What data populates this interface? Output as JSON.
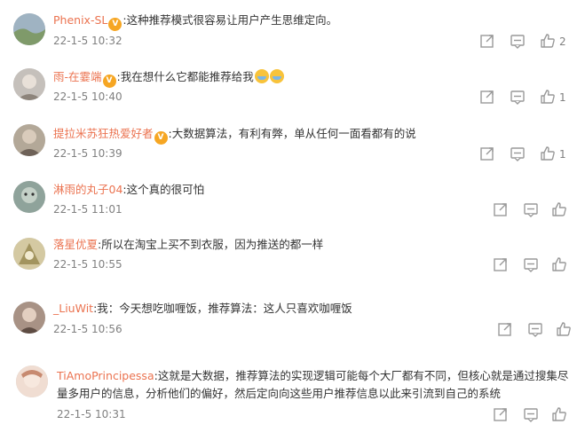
{
  "comments": [
    {
      "user": "Phenix-SL",
      "text": ":这种推荐模式很容易让用户产生思维定向。",
      "time": "22-1-5 10:32",
      "likes": "2",
      "avatar_color": "#8aa37c"
    },
    {
      "user": "雨-在霎端",
      "text": ":我在想什么它都能推荐给我",
      "time": "22-1-5 10:40",
      "likes": "1",
      "avatar_color": "#b9b3ad"
    },
    {
      "user": "提拉米苏狂热爱好者",
      "text": ":大数据算法，有利有弊，单从任何一面看都有的说",
      "time": "22-1-5 10:39",
      "likes": "1",
      "avatar_color": "#a69a8c"
    },
    {
      "user": "淋雨的丸子04",
      "text": ":这个真的很可怕",
      "time": "22-1-5 11:01",
      "likes": "",
      "avatar_color": "#7d8f86"
    },
    {
      "user": "落星优夏",
      "text": ":所以在淘宝上买不到衣服，因为推送的都一样",
      "time": "22-1-5 10:55",
      "likes": "",
      "avatar_color": "#c8b98a"
    },
    {
      "user": "_LiuWit",
      "text": ":我：今天想吃咖喱饭，推荐算法：这人只喜欢咖喱饭",
      "time": "22-1-5 10:56",
      "likes": "",
      "avatar_color": "#9f8c80"
    },
    {
      "user": "TiAmoPrincipessa",
      "text": ":这就是大数据，推荐算法的实现逻辑可能每个大厂都有不同，但核心就是通过搜集尽",
      "text2": "量多用户的信息，分析他们的偏好，然后定向向这些用户推荐信息以此来引流到自己的系统",
      "time": "22-1-5 10:31",
      "likes": "",
      "avatar_color": "#e0b8a8"
    }
  ],
  "badge_label": "V",
  "icons": {
    "share": "share-icon",
    "comment": "comment-icon",
    "like": "thumbs-up-icon",
    "verified": "verified-badge-icon",
    "emoji": "crying-laughing-emoji-icon"
  },
  "colors": {
    "username": "#eb7350",
    "text": "#333333",
    "meta": "#808080"
  }
}
